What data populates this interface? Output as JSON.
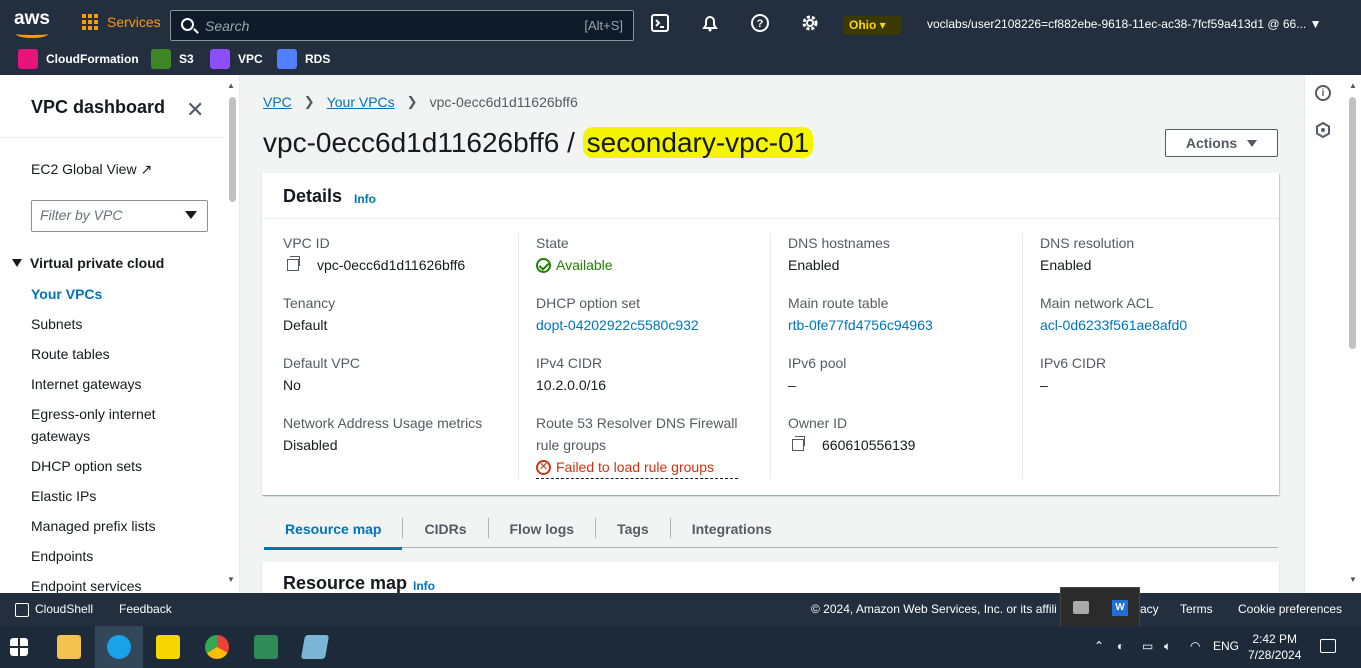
{
  "topnav": {
    "logo": "aws",
    "services": "Services",
    "search_placeholder": "Search",
    "search_hint": "[Alt+S]",
    "region": "Ohio",
    "account": "voclabs/user2108226=cf882ebe-9618-11ec-ac38-7fcf59a413d1 @ 66...",
    "favorites": [
      {
        "label": "CloudFormation",
        "color": "#e7157b",
        "icon": "cloudformation-icon"
      },
      {
        "label": "S3",
        "color": "#3f8624",
        "icon": "s3-icon"
      },
      {
        "label": "VPC",
        "color": "#8c4fff",
        "icon": "vpc-icon"
      },
      {
        "label": "RDS",
        "color": "#527fff",
        "icon": "rds-icon"
      }
    ]
  },
  "sidebar": {
    "title": "VPC dashboard",
    "ec2_global": "EC2 Global View",
    "filter_placeholder": "Filter by VPC",
    "section": "Virtual private cloud",
    "items": [
      "Your VPCs",
      "Subnets",
      "Route tables",
      "Internet gateways",
      "Egress-only internet gateways",
      "DHCP option sets",
      "Elastic IPs",
      "Managed prefix lists",
      "Endpoints",
      "Endpoint services"
    ]
  },
  "main": {
    "breadcrumb": [
      "VPC",
      "Your VPCs",
      "vpc-0ecc6d1d11626bff6"
    ],
    "title_id": "vpc-0ecc6d1d11626bff6",
    "title_sep": " / ",
    "title_name": "secondary-vpc-01",
    "actions": "Actions",
    "details": {
      "title": "Details",
      "info": "Info",
      "fields": {
        "vpc_id": {
          "k": "VPC ID",
          "v": "vpc-0ecc6d1d11626bff6"
        },
        "state": {
          "k": "State",
          "v": "Available"
        },
        "dns_hostnames": {
          "k": "DNS hostnames",
          "v": "Enabled"
        },
        "dns_resolution": {
          "k": "DNS resolution",
          "v": "Enabled"
        },
        "tenancy": {
          "k": "Tenancy",
          "v": "Default"
        },
        "dhcp": {
          "k": "DHCP option set",
          "v": "dopt-04202922c5580c932"
        },
        "main_route": {
          "k": "Main route table",
          "v": "rtb-0fe77fd4756c94963"
        },
        "main_acl": {
          "k": "Main network ACL",
          "v": "acl-0d6233f561ae8afd0"
        },
        "default_vpc": {
          "k": "Default VPC",
          "v": "No"
        },
        "ipv4": {
          "k": "IPv4 CIDR",
          "v": "10.2.0.0/16"
        },
        "ipv6_pool": {
          "k": "IPv6 pool",
          "v": "–"
        },
        "ipv6_cidr": {
          "k": "IPv6 CIDR",
          "v": "–"
        },
        "nau": {
          "k": "Network Address Usage metrics",
          "v": "Disabled"
        },
        "r53_k1": "Route 53 Resolver DNS Firewall",
        "r53_k2": "rule groups",
        "r53_v": "Failed to load rule groups",
        "owner": {
          "k": "Owner ID",
          "v": "660610556139"
        }
      }
    },
    "tabs": [
      "Resource map",
      "CIDRs",
      "Flow logs",
      "Tags",
      "Integrations"
    ],
    "resource_map": {
      "title": "Resource map",
      "info": "Info"
    }
  },
  "footer": {
    "cloudshell": "CloudShell",
    "feedback": "Feedback",
    "copyright": "© 2024, Amazon Web Services, Inc. or its affili",
    "privacy_tail": "acy",
    "terms": "Terms",
    "cookie": "Cookie preferences"
  },
  "taskbar": {
    "lang": "ENG",
    "time": "2:42 PM",
    "date": "7/28/2024"
  }
}
